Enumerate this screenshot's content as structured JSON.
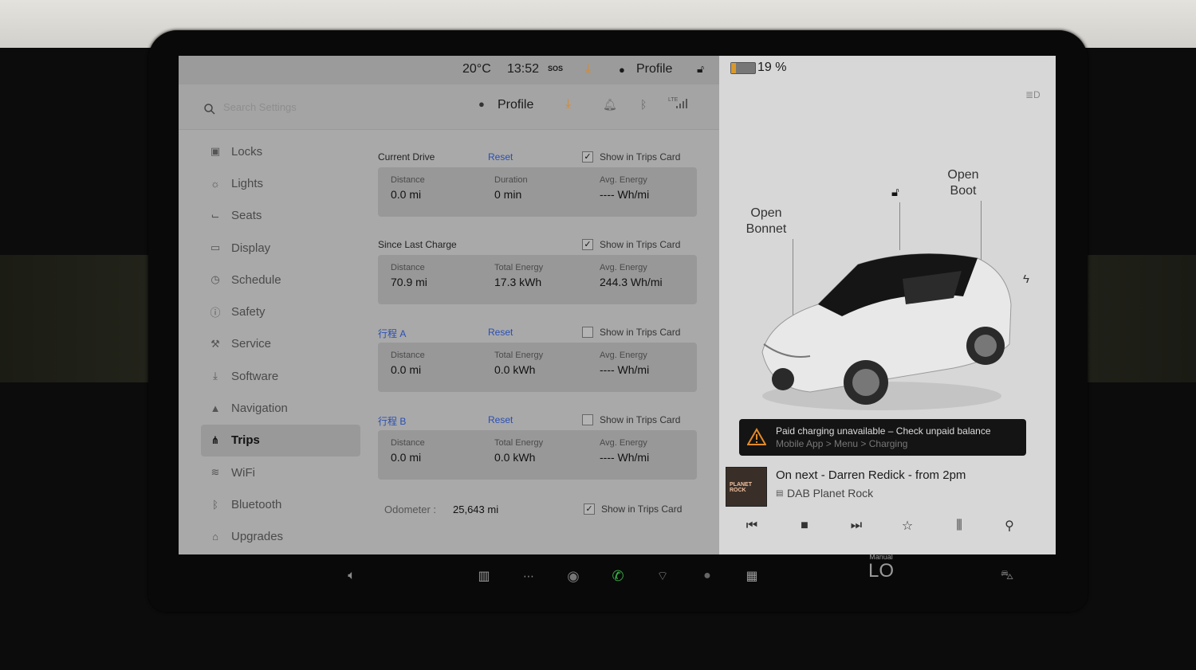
{
  "status": {
    "temperature": "20°C",
    "time": "13:52",
    "sos": "SOS",
    "profile_label": "Profile",
    "battery_percent": "19 %",
    "battery_level": 0.19
  },
  "header": {
    "search_placeholder": "Search Settings",
    "profile_label": "Profile",
    "lte": "LTE"
  },
  "sidebar": {
    "items": [
      {
        "label": "Locks",
        "icon": "lock-icon"
      },
      {
        "label": "Lights",
        "icon": "lights-icon"
      },
      {
        "label": "Seats",
        "icon": "seat-icon"
      },
      {
        "label": "Display",
        "icon": "display-icon"
      },
      {
        "label": "Schedule",
        "icon": "schedule-icon"
      },
      {
        "label": "Safety",
        "icon": "safety-icon"
      },
      {
        "label": "Service",
        "icon": "wrench-icon"
      },
      {
        "label": "Software",
        "icon": "download-icon"
      },
      {
        "label": "Navigation",
        "icon": "navigation-icon"
      },
      {
        "label": "Trips",
        "icon": "trips-icon",
        "active": true
      },
      {
        "label": "WiFi",
        "icon": "wifi-icon"
      },
      {
        "label": "Bluetooth",
        "icon": "bluetooth-icon"
      },
      {
        "label": "Upgrades",
        "icon": "upgrades-icon"
      }
    ]
  },
  "trips": {
    "show_label": "Show in Trips Card",
    "reset_label": "Reset",
    "current_drive": {
      "title": "Current Drive",
      "checked": true,
      "stats": [
        {
          "label": "Distance",
          "value": "0.0 mi"
        },
        {
          "label": "Duration",
          "value": "0 min"
        },
        {
          "label": "Avg. Energy",
          "value": "---- Wh/mi"
        }
      ]
    },
    "since_last_charge": {
      "title": "Since Last Charge",
      "checked": true,
      "stats": [
        {
          "label": "Distance",
          "value": "70.9 mi"
        },
        {
          "label": "Total Energy",
          "value": "17.3 kWh"
        },
        {
          "label": "Avg. Energy",
          "value": "244.3 Wh/mi"
        }
      ]
    },
    "trip_a": {
      "title": "行程 A",
      "checked": false,
      "stats": [
        {
          "label": "Distance",
          "value": "0.0 mi"
        },
        {
          "label": "Total Energy",
          "value": "0.0 kWh"
        },
        {
          "label": "Avg. Energy",
          "value": "---- Wh/mi"
        }
      ]
    },
    "trip_b": {
      "title": "行程 B",
      "checked": false,
      "stats": [
        {
          "label": "Distance",
          "value": "0.0 mi"
        },
        {
          "label": "Total Energy",
          "value": "0.0 kWh"
        },
        {
          "label": "Avg. Energy",
          "value": "---- Wh/mi"
        }
      ]
    },
    "odometer": {
      "label": "Odometer :",
      "value": "25,643 mi",
      "checked": true
    }
  },
  "car": {
    "open_bonnet": [
      "Open",
      "Bonnet"
    ],
    "open_boot": [
      "Open",
      "Boot"
    ]
  },
  "alert": {
    "title": "Paid charging unavailable – Check unpaid balance",
    "subtitle": "Mobile App > Menu > Charging"
  },
  "media": {
    "art_text": "PLANET ROCK",
    "now": "On next - Darren Redick - from 2pm",
    "station": "DAB Planet Rock"
  },
  "climate": {
    "mode": "Manual",
    "value": "LO"
  },
  "colors": {
    "accent_blue": "#2a4fb5",
    "orange": "#d9892a",
    "green_phone": "#3bb34a",
    "alert_bg": "#141414"
  }
}
